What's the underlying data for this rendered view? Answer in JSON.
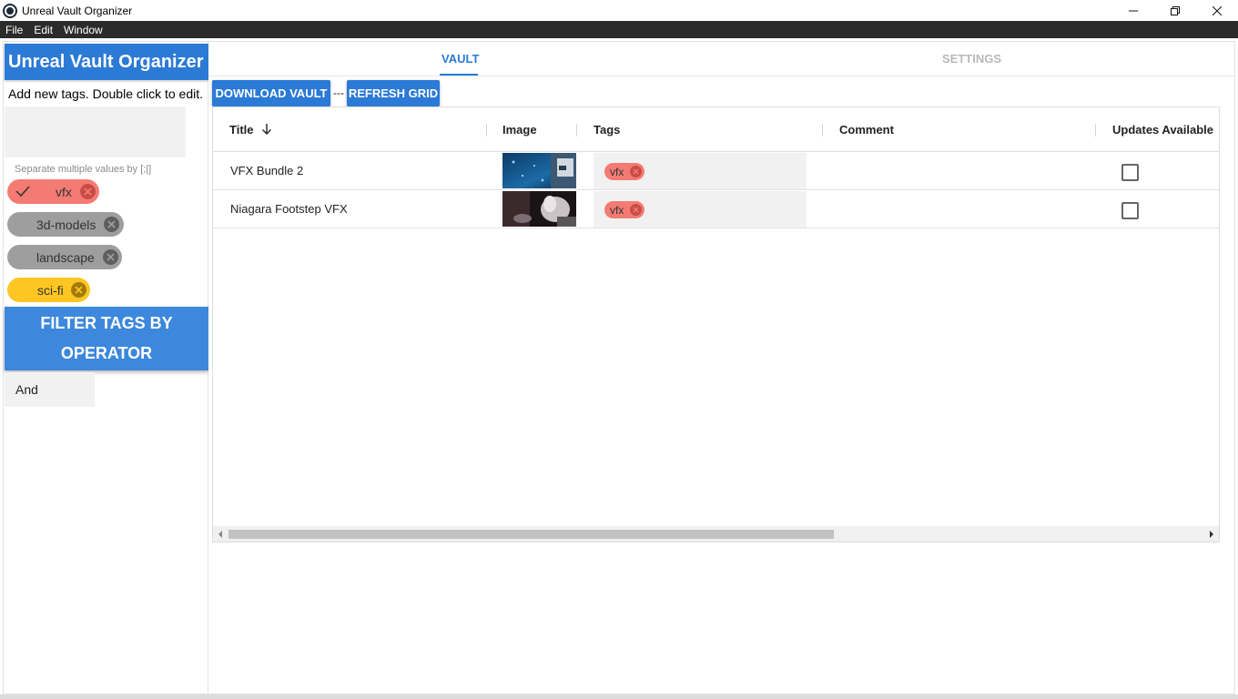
{
  "window": {
    "title": "Unreal Vault Organizer",
    "minimize_icon": "minimize-icon",
    "maximize_icon": "restore-icon",
    "close_icon": "close-icon"
  },
  "menu": [
    "File",
    "Edit",
    "Window"
  ],
  "sidebar": {
    "app_title": "Unreal Vault Organizer",
    "hint": "Add new tags. Double click to edit.",
    "separator_hint": "Separate multiple values by [;|]",
    "tags": [
      {
        "label": "vfx",
        "color": "#f47b73",
        "selected": true
      },
      {
        "label": "3d-models",
        "color": "#9e9e9e",
        "selected": false
      },
      {
        "label": "landscape",
        "color": "#9e9e9e",
        "selected": false
      },
      {
        "label": "sci-fi",
        "color": "#fdc623",
        "selected": false
      }
    ],
    "filter_button_line1": "FILTER TAGS BY",
    "filter_button_line2": "OPERATOR",
    "operator_value": "And"
  },
  "tabs": [
    {
      "label": "VAULT",
      "active": true
    },
    {
      "label": "SETTINGS",
      "active": false
    }
  ],
  "toolbar": {
    "download_label": "DOWNLOAD VAULT",
    "separator": "---",
    "refresh_label": "REFRESH GRID"
  },
  "grid": {
    "columns": [
      "Title",
      "Image",
      "Tags",
      "Comment",
      "Updates Available"
    ],
    "sort_column": "Title",
    "sort_direction": "descending",
    "rows": [
      {
        "title": "VFX Bundle 2",
        "tags": [
          "vfx"
        ],
        "comment": "",
        "updates_available": false
      },
      {
        "title": "Niagara Footstep VFX",
        "tags": [
          "vfx"
        ],
        "comment": "",
        "updates_available": false
      }
    ]
  },
  "colors": {
    "accent": "#2b7ad6",
    "menu_bg": "#2b2b2b",
    "tag_vfx": "#f47b73",
    "tag_grey": "#9e9e9e",
    "tag_yellow": "#fdc623"
  }
}
